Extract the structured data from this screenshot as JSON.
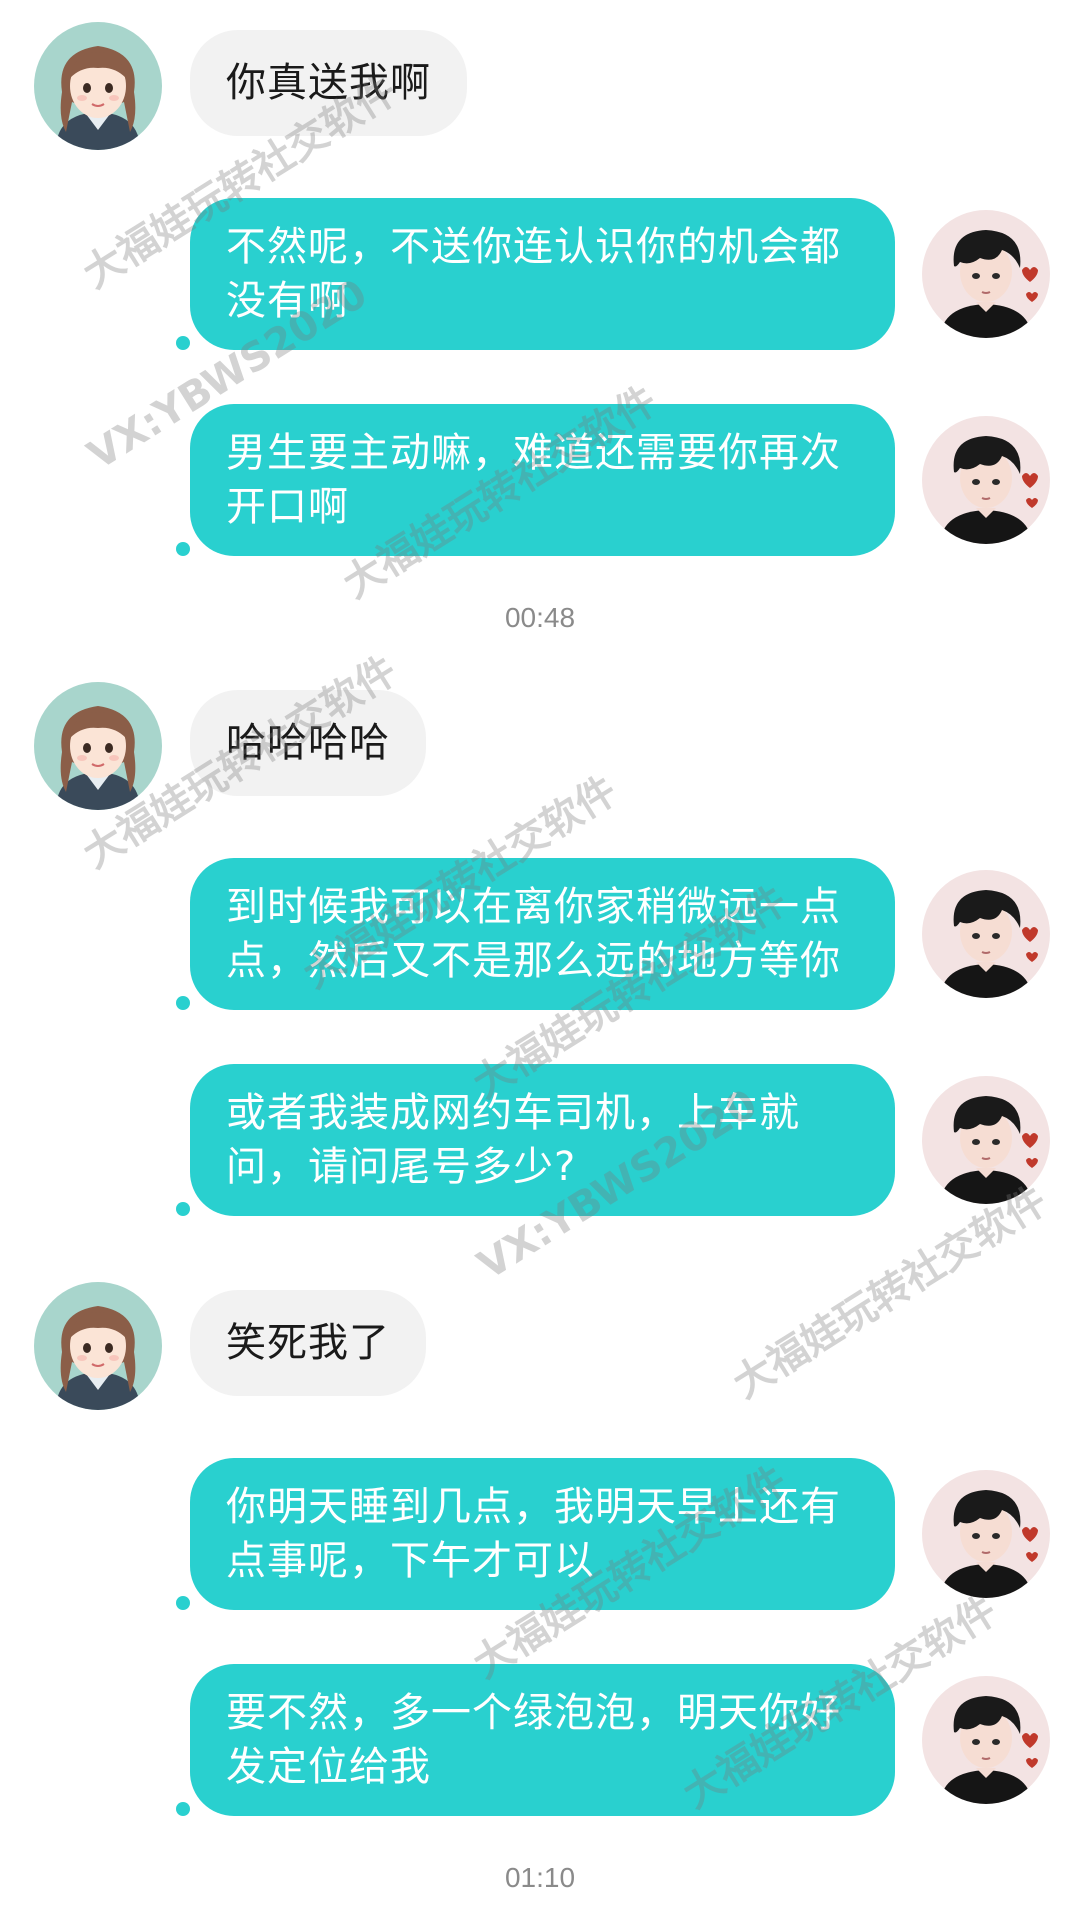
{
  "messages": [
    {
      "side": "in",
      "text": "你真送我啊"
    },
    {
      "side": "out",
      "text": "不然呢，不送你连认识你的机会都没有啊"
    },
    {
      "side": "out",
      "text": "男生要主动嘛，难道还需要你再次开口啊"
    },
    {
      "time": "00:48"
    },
    {
      "side": "in",
      "text": "哈哈哈哈"
    },
    {
      "side": "out",
      "text": "到时候我可以在离你家稍微远一点点，然后又不是那么远的地方等你"
    },
    {
      "side": "out",
      "text": "或者我装成网约车司机，上车就问，请问尾号多少?"
    },
    {
      "side": "in",
      "text": "笑死我了"
    },
    {
      "side": "out",
      "text": "你明天睡到几点，我明天早上还有点事呢，下午才可以"
    },
    {
      "side": "out",
      "text": "要不然，多一个绿泡泡，明天你好发定位给我"
    },
    {
      "time": "01:10"
    }
  ],
  "watermarks": {
    "brand": "大福娃玩转社交软件",
    "vx": "VX:YBWS2020"
  },
  "colors": {
    "outgoing_bubble": "#29d0cf",
    "incoming_bubble": "#f2f2f2",
    "timestamp": "#8a8a8a"
  }
}
